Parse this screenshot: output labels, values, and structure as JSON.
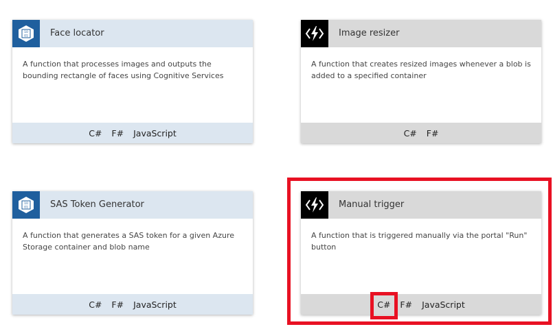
{
  "cards": [
    {
      "title": "Face locator",
      "description": "A function that processes images and outputs the bounding rectangle of faces using Cognitive Services",
      "icon": "blob-storage-icon",
      "languages": [
        "C#",
        "F#",
        "JavaScript"
      ]
    },
    {
      "title": "Image resizer",
      "description": "A function that creates resized images whenever a blob is added to a specified container",
      "icon": "function-bolt-icon",
      "languages": [
        "C#",
        "F#"
      ]
    },
    {
      "title": "SAS Token Generator",
      "description": "A function that generates a SAS token for a given Azure Storage container and blob name",
      "icon": "blob-storage-icon",
      "languages": [
        "C#",
        "F#",
        "JavaScript"
      ]
    },
    {
      "title": "Manual trigger",
      "description": "A function that is triggered manually via the portal \"Run\" button",
      "icon": "function-bolt-icon",
      "languages": [
        "C#",
        "F#",
        "JavaScript"
      ]
    }
  ],
  "colors": {
    "blob_header": "#dce6f0",
    "blob_icon_bg": "#1f5f9e",
    "func_header": "#d9d9d9",
    "func_icon_bg": "#000000",
    "highlight": "#e81123"
  }
}
